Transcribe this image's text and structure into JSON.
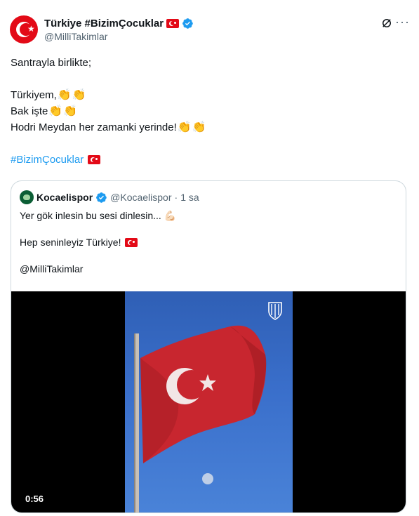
{
  "author": {
    "display_name": "Türkiye #BizimÇocuklar",
    "handle": "@MilliTakimlar"
  },
  "tweet": {
    "lines": [
      "Santrayla birlikte;",
      "Türkiyem,",
      "Bak işte",
      "Hodri Meydan her zamanki yerinde!"
    ],
    "clap_emoji": "👏",
    "hashtag": "#BizimÇocuklar"
  },
  "quoted_tweet": {
    "display_name": "Kocaelispor",
    "handle": "@Kocaelispor",
    "separator": "·",
    "time": "1 sa",
    "lines": [
      "Yer gök inlesin bu sesi dinlesin...",
      "Hep seninleyiz Türkiye!",
      "@MilliTakimlar"
    ],
    "muscle_emoji": "💪🏻",
    "video": {
      "duration": "0:56"
    }
  },
  "colors": {
    "accent": "#1d9bf0",
    "flag_red": "#e30a17",
    "secondary_text": "#536471",
    "border": "#cfd9de"
  },
  "icons": [
    "verified-badge-icon",
    "grok-icon",
    "more-options-icon",
    "turkey-flag-icon",
    "kocaelispor-crest-icon"
  ]
}
